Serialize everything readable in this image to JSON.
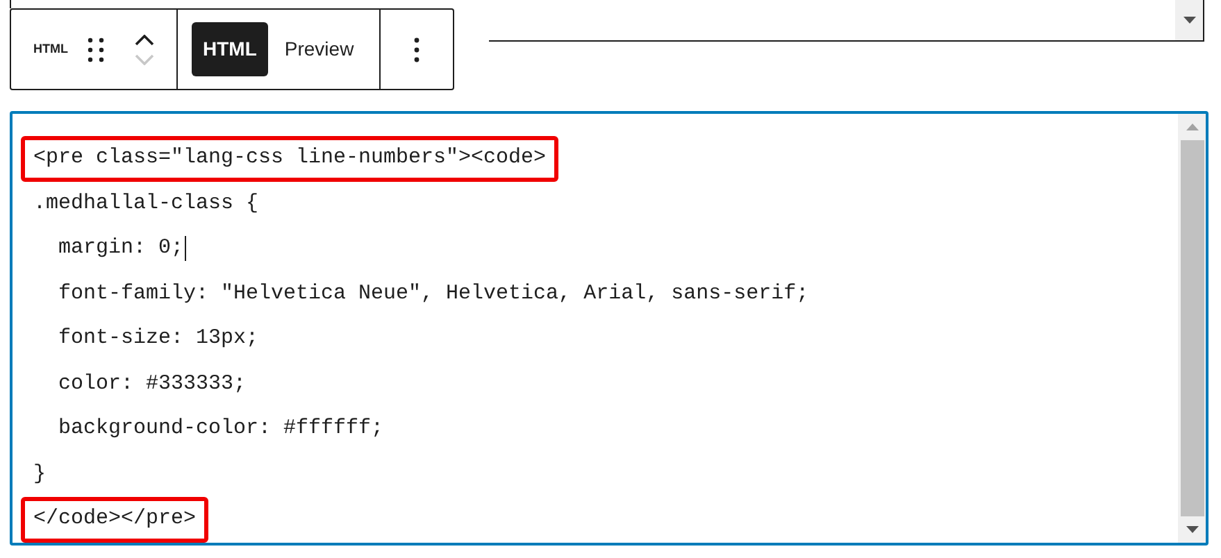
{
  "block_toolbar": {
    "block_label": "HTML",
    "move_up": {
      "disabled": false
    },
    "move_down": {
      "disabled": true
    },
    "modes": [
      {
        "label": "HTML",
        "selected": true
      },
      {
        "label": "Preview",
        "selected": false
      }
    ]
  },
  "code_editor": {
    "lines": [
      {
        "text": "<pre class=\"lang-css line-numbers\"><code>",
        "highlighted": true,
        "cursor": false
      },
      {
        "text": ".medhallal-class {",
        "highlighted": false,
        "cursor": false
      },
      {
        "text": "  margin: 0;",
        "highlighted": false,
        "cursor": true
      },
      {
        "text": "  font-family: \"Helvetica Neue\", Helvetica, Arial, sans-serif;",
        "highlighted": false,
        "cursor": false
      },
      {
        "text": "  font-size: 13px;",
        "highlighted": false,
        "cursor": false
      },
      {
        "text": "  color: #333333;",
        "highlighted": false,
        "cursor": false
      },
      {
        "text": "  background-color: #ffffff;",
        "highlighted": false,
        "cursor": false
      },
      {
        "text": "}",
        "highlighted": false,
        "cursor": false
      },
      {
        "text": "</code></pre>",
        "highlighted": true,
        "cursor": false
      }
    ]
  }
}
